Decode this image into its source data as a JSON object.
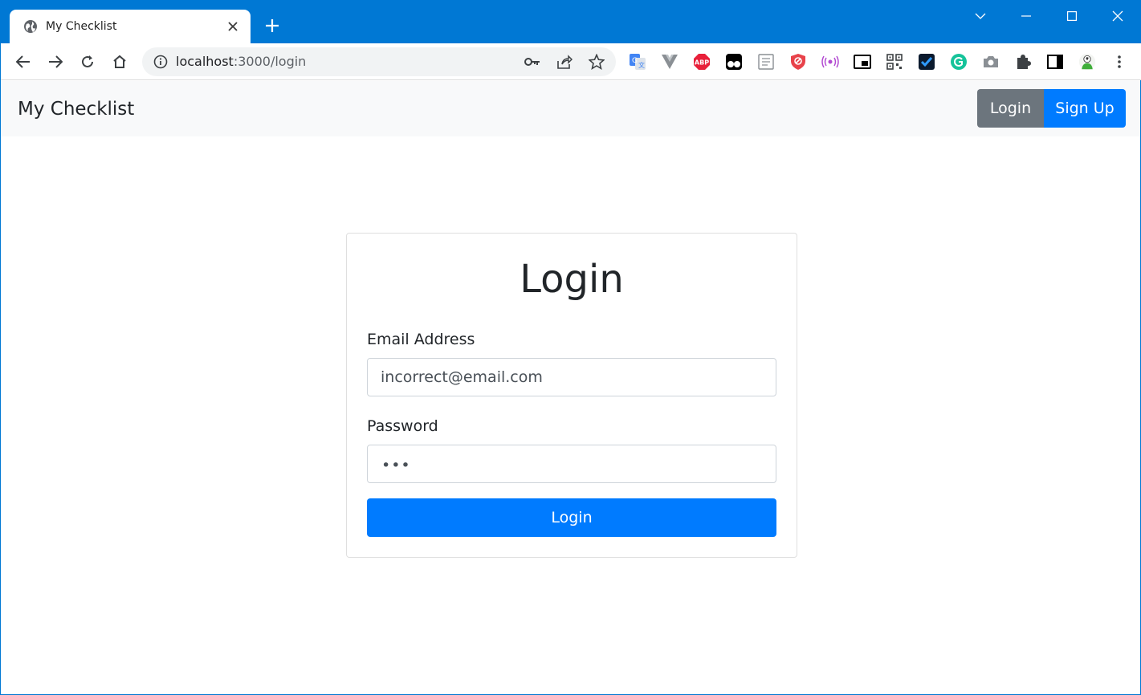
{
  "browser": {
    "tab_title": "My Checklist",
    "url_host": "localhost",
    "url_path": ":3000/login",
    "accent_color": "#0078d4",
    "extensions": [
      "google-translate-icon",
      "vue-devtools-icon",
      "adblock-plus-icon",
      "tampermonkey-icon",
      "reader-icon",
      "privacy-shield-icon",
      "broadcast-icon",
      "picture-in-picture-icon",
      "qr-code-icon",
      "checkmark-app-icon",
      "grammarly-icon",
      "camera-icon",
      "extensions-puzzle-icon",
      "side-panel-icon",
      "profile-avatar-icon",
      "more-menu-icon"
    ],
    "extension_labels": {
      "adblock": "ABP"
    }
  },
  "navbar": {
    "brand": "My Checklist",
    "login_label": "Login",
    "signup_label": "Sign Up"
  },
  "login_form": {
    "title": "Login",
    "email_label": "Email Address",
    "email_value": "incorrect@email.com",
    "password_label": "Password",
    "password_mask": "•••",
    "submit_label": "Login"
  },
  "colors": {
    "primary": "#007bff",
    "secondary": "#6c757d",
    "navbar_bg": "#f8f9fa"
  }
}
